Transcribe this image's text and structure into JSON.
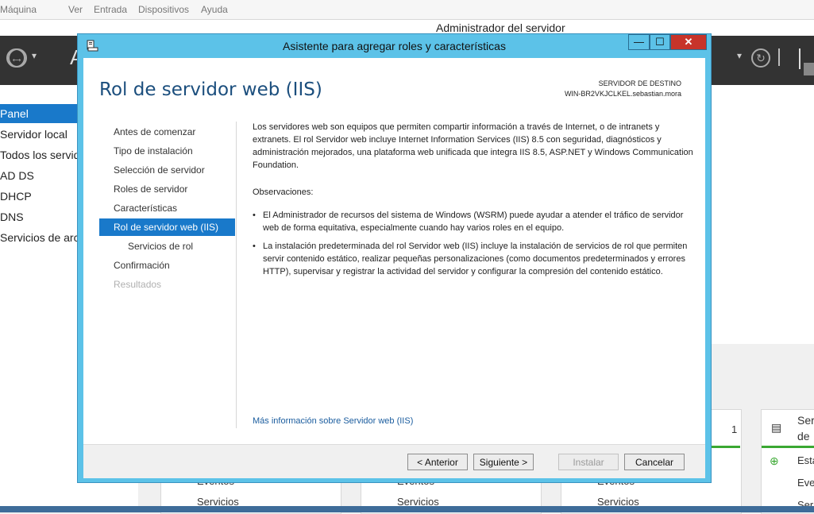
{
  "vm_menu": [
    "Máquina",
    "Ver",
    "Entrada",
    "Dispositivos",
    "Ayuda"
  ],
  "server_manager": {
    "title": "Administrador del servidor",
    "header_partial": "A",
    "sidebar": [
      "Panel",
      "Servidor local",
      "Todos los servid",
      "AD DS",
      "DHCP",
      "DNS",
      "Servicios de arch"
    ],
    "active_sidebar": "Panel",
    "tiles": {
      "count": "1",
      "tile_title_line1": "Ser",
      "tile_title_line2": "de",
      "tile_row1": "Esta",
      "tile_row2": "Eve",
      "tile_row3": "Ser",
      "events_label": "Eventos",
      "services_label": "Servicios"
    }
  },
  "wizard": {
    "title": "Asistente para agregar roles y características",
    "heading": "Rol de servidor web (IIS)",
    "destination_label": "SERVIDOR DE DESTINO",
    "destination_value": "WIN-BR2VKJCLKEL.sebastian.mora",
    "steps": [
      {
        "label": "Antes de comenzar",
        "state": "normal"
      },
      {
        "label": "Tipo de instalación",
        "state": "normal"
      },
      {
        "label": "Selección de servidor",
        "state": "normal"
      },
      {
        "label": "Roles de servidor",
        "state": "normal"
      },
      {
        "label": "Características",
        "state": "normal"
      },
      {
        "label": "Rol de servidor web (IIS)",
        "state": "active"
      },
      {
        "label": "Servicios de rol",
        "state": "sub"
      },
      {
        "label": "Confirmación",
        "state": "normal"
      },
      {
        "label": "Resultados",
        "state": "disabled"
      }
    ],
    "intro": "Los servidores web son equipos que permiten compartir información a través de Internet, o de intranets y extranets. El rol Servidor web incluye Internet Information Services (IIS) 8.5 con seguridad, diagnósticos y administración mejorados, una plataforma web unificada que integra IIS 8.5, ASP.NET y Windows Communication Foundation.",
    "observations_label": "Observaciones:",
    "bullets": [
      "El Administrador de recursos del sistema de Windows (WSRM) puede ayudar a atender el tráfico de servidor web de forma equitativa, especialmente cuando hay varios roles en el equipo.",
      "La instalación predeterminada del rol Servidor web (IIS) incluye la instalación de servicios de rol que permiten servir contenido estático, realizar pequeñas personalizaciones (como documentos predeterminados y errores HTTP), supervisar y registrar la actividad del servidor y configurar la compresión del contenido estático."
    ],
    "more_link": "Más información sobre Servidor web (IIS)",
    "buttons": {
      "back": "< Anterior",
      "next": "Siguiente >",
      "install": "Instalar",
      "cancel": "Cancelar"
    },
    "window_controls": {
      "minimize": "—",
      "maximize": "☐",
      "close": "✕"
    }
  }
}
